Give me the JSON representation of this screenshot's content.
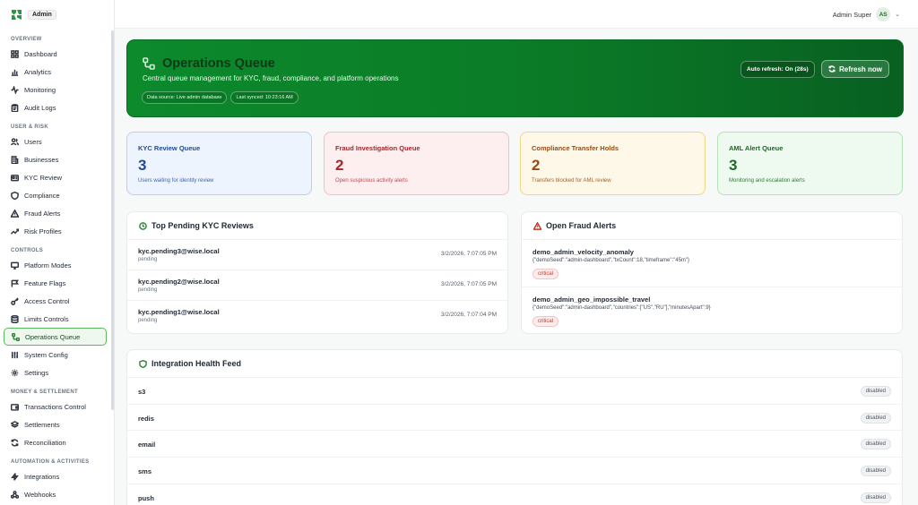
{
  "brand": {
    "badge": "Admin",
    "accent": "#1f9d3f"
  },
  "topbar": {
    "user_name": "Admin Super",
    "avatar_initials": "AS"
  },
  "sidebar": {
    "sections": [
      {
        "title": "OVERVIEW",
        "items": [
          {
            "label": "Dashboard",
            "icon": "dashboard-icon"
          },
          {
            "label": "Analytics",
            "icon": "bar-chart-icon"
          },
          {
            "label": "Monitoring",
            "icon": "activity-icon"
          },
          {
            "label": "Audit Logs",
            "icon": "clipboard-icon"
          }
        ]
      },
      {
        "title": "USER & RISK",
        "items": [
          {
            "label": "Users",
            "icon": "users-icon"
          },
          {
            "label": "Businesses",
            "icon": "building-icon"
          },
          {
            "label": "KYC Review",
            "icon": "id-card-icon"
          },
          {
            "label": "Compliance",
            "icon": "shield-icon"
          },
          {
            "label": "Fraud Alerts",
            "icon": "warning-triangle-icon"
          },
          {
            "label": "Risk Profiles",
            "icon": "trending-up-icon"
          }
        ]
      },
      {
        "title": "CONTROLS",
        "items": [
          {
            "label": "Platform Modes",
            "icon": "monitor-icon"
          },
          {
            "label": "Feature Flags",
            "icon": "flag-icon"
          },
          {
            "label": "Access Control",
            "icon": "key-icon"
          },
          {
            "label": "Limits Controls",
            "icon": "database-icon"
          },
          {
            "label": "Operations Queue",
            "icon": "workflow-icon",
            "active": true
          },
          {
            "label": "System Config",
            "icon": "sliders-icon"
          },
          {
            "label": "Settings",
            "icon": "gear-icon"
          }
        ]
      },
      {
        "title": "MONEY & SETTLEMENT",
        "items": [
          {
            "label": "Transactions Control",
            "icon": "wallet-icon"
          },
          {
            "label": "Settlements",
            "icon": "layers-icon"
          },
          {
            "label": "Reconciliation",
            "icon": "refresh-icon"
          }
        ]
      },
      {
        "title": "AUTOMATION & ACTIVITIES",
        "items": [
          {
            "label": "Integrations",
            "icon": "zap-icon"
          },
          {
            "label": "Webhooks",
            "icon": "webhook-icon"
          }
        ]
      }
    ]
  },
  "hero": {
    "title": "Operations Queue",
    "subtitle": "Central queue management for KYC, fraud, compliance, and platform operations",
    "data_source": "Data source: Live admin database",
    "last_synced": "Last synced: 10:23:16 AM",
    "auto_refresh": "Auto refresh: On (28s)",
    "refresh_label": "Refresh now"
  },
  "stats": [
    {
      "title": "KYC Review Queue",
      "value": "3",
      "desc": "Users waiting for identity review"
    },
    {
      "title": "Fraud Investigation Queue",
      "value": "2",
      "desc": "Open suspicious activity alerts"
    },
    {
      "title": "Compliance Transfer Holds",
      "value": "2",
      "desc": "Transfers blocked for AML review"
    },
    {
      "title": "AML Alert Queue",
      "value": "3",
      "desc": "Monitoring and escalation alerts"
    }
  ],
  "kyc_panel": {
    "title": "Top Pending KYC Reviews",
    "rows": [
      {
        "email": "kyc.pending3@wise.local",
        "status": "pending",
        "time": "3/2/2026, 7:07:05 PM"
      },
      {
        "email": "kyc.pending2@wise.local",
        "status": "pending",
        "time": "3/2/2026, 7:07:05 PM"
      },
      {
        "email": "kyc.pending1@wise.local",
        "status": "pending",
        "time": "3/2/2026, 7:07:04 PM"
      }
    ]
  },
  "fraud_panel": {
    "title": "Open Fraud Alerts",
    "rows": [
      {
        "name": "demo_admin_velocity_anomaly",
        "detail": "{\"demoSeed\":\"admin-dashboard\",\"txCount\":18,\"timeframe\":\"45m\"}",
        "severity": "critical"
      },
      {
        "name": "demo_admin_geo_impossible_travel",
        "detail": "{\"demoSeed\":\"admin-dashboard\",\"countries\":[\"US\",\"RU\"],\"minutesApart\":9}",
        "severity": "critical"
      }
    ]
  },
  "health_panel": {
    "title": "Integration Health Feed",
    "rows": [
      {
        "name": "s3",
        "status": "disabled"
      },
      {
        "name": "redis",
        "status": "disabled"
      },
      {
        "name": "email",
        "status": "disabled"
      },
      {
        "name": "sms",
        "status": "disabled"
      },
      {
        "name": "push",
        "status": "disabled"
      }
    ]
  }
}
